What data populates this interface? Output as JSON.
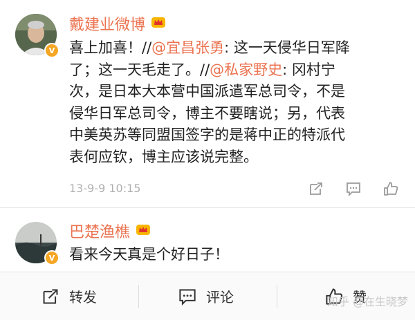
{
  "post": {
    "author": "戴建业微博",
    "timestamp": "13-9-9 10:15",
    "lines": [
      [
        {
          "t": "喜上加喜！//"
        },
        {
          "t": "@宜昌张勇",
          "at": true
        },
        {
          "t": ": 这一天侵华日军降"
        }
      ],
      [
        {
          "t": "了；这一天毛走了。//"
        },
        {
          "t": "@私家野史",
          "at": true
        },
        {
          "t": ": 冈村宁"
        }
      ],
      [
        {
          "t": "次，是日本大本营中国派遣军总司令，不是"
        }
      ],
      [
        {
          "t": "侵华日军总司令，博主不要瞎说；另，代表"
        }
      ],
      [
        {
          "t": "中美英苏等同盟国签字的是蒋中正的特派代"
        }
      ],
      [
        {
          "t": "表何应钦，博主应该说完整。"
        }
      ]
    ]
  },
  "comment": {
    "author": "巴楚渔樵",
    "text": "看来今天真是个好日子！"
  },
  "bottom_bar": {
    "repost_label": "转发",
    "comment_label": "评论",
    "like_label": "赞"
  },
  "watermark": "知乎 @在生晓梦",
  "colors": {
    "username": "#eb7350",
    "mention": "#eb7350",
    "verified": "#f5a623"
  }
}
